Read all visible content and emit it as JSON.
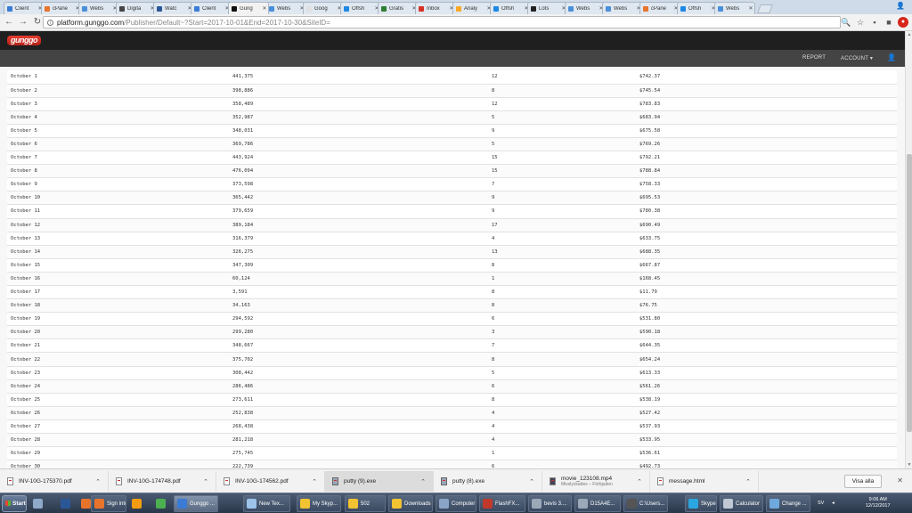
{
  "browser": {
    "tabs": [
      {
        "label": "Client",
        "color": "#3a7bd5",
        "active": false
      },
      {
        "label": "cPane",
        "color": "#e8742c",
        "active": false
      },
      {
        "label": "Webs",
        "color": "#4a8fd8",
        "active": false
      },
      {
        "label": "Digita",
        "color": "#444444",
        "active": false
      },
      {
        "label": "Watc",
        "color": "#2b5797",
        "active": false
      },
      {
        "label": "Client",
        "color": "#3a7bd5",
        "active": false
      },
      {
        "label": "Gung",
        "color": "#111111",
        "active": true
      },
      {
        "label": "Webs",
        "color": "#4a8fd8",
        "active": false
      },
      {
        "label": "Goog",
        "color": "#e0e0e0",
        "active": false
      },
      {
        "label": "Offsh",
        "color": "#1e88e5",
        "active": false
      },
      {
        "label": "Gratis",
        "color": "#2e7d32",
        "active": false
      },
      {
        "label": "Inbox",
        "color": "#d93025",
        "active": false
      },
      {
        "label": "Analy",
        "color": "#f9a825",
        "active": false
      },
      {
        "label": "Offsh",
        "color": "#1e88e5",
        "active": false
      },
      {
        "label": "Lots",
        "color": "#222222",
        "active": false
      },
      {
        "label": "Webs",
        "color": "#4a8fd8",
        "active": false
      },
      {
        "label": "Webs",
        "color": "#4a8fd8",
        "active": false
      },
      {
        "label": "cPane",
        "color": "#e8742c",
        "active": false
      },
      {
        "label": "Offsh",
        "color": "#1e88e5",
        "active": false
      },
      {
        "label": "Webs",
        "color": "#4a8fd8",
        "active": false
      }
    ],
    "url_host": "platform.gunggo.com",
    "url_path": "/Publisher/Default~?Start=2017-10-01&End=2017-10-30&SiteID="
  },
  "site": {
    "logo_text": "gunggo",
    "nav_report": "REPORT",
    "nav_account": "ACCOUNT ▾"
  },
  "rows": [
    {
      "date": "October 1",
      "impressions": "441,375",
      "clicks": "12",
      "revenue": "$742.37"
    },
    {
      "date": "October 2",
      "impressions": "398,886",
      "clicks": "8",
      "revenue": "$745.54"
    },
    {
      "date": "October 3",
      "impressions": "358,489",
      "clicks": "12",
      "revenue": "$783.83"
    },
    {
      "date": "October 4",
      "impressions": "352,987",
      "clicks": "5",
      "revenue": "$683.94"
    },
    {
      "date": "October 5",
      "impressions": "348,031",
      "clicks": "9",
      "revenue": "$675.58"
    },
    {
      "date": "October 6",
      "impressions": "369,786",
      "clicks": "5",
      "revenue": "$769.26"
    },
    {
      "date": "October 7",
      "impressions": "443,924",
      "clicks": "15",
      "revenue": "$792.21"
    },
    {
      "date": "October 8",
      "impressions": "476,094",
      "clicks": "15",
      "revenue": "$788.84"
    },
    {
      "date": "October 9",
      "impressions": "373,598",
      "clicks": "7",
      "revenue": "$758.33"
    },
    {
      "date": "October 10",
      "impressions": "365,442",
      "clicks": "9",
      "revenue": "$695.53"
    },
    {
      "date": "October 11",
      "impressions": "379,659",
      "clicks": "9",
      "revenue": "$780.38"
    },
    {
      "date": "October 12",
      "impressions": "389,184",
      "clicks": "17",
      "revenue": "$690.49"
    },
    {
      "date": "October 13",
      "impressions": "316,379",
      "clicks": "4",
      "revenue": "$633.75"
    },
    {
      "date": "October 14",
      "impressions": "326,275",
      "clicks": "13",
      "revenue": "$688.35"
    },
    {
      "date": "October 15",
      "impressions": "347,309",
      "clicks": "8",
      "revenue": "$667.87"
    },
    {
      "date": "October 16",
      "impressions": "60,124",
      "clicks": "1",
      "revenue": "$168.45"
    },
    {
      "date": "October 17",
      "impressions": "3,591",
      "clicks": "8",
      "revenue": "$11.79"
    },
    {
      "date": "October 18",
      "impressions": "34,163",
      "clicks": "8",
      "revenue": "$76.75"
    },
    {
      "date": "October 19",
      "impressions": "294,592",
      "clicks": "6",
      "revenue": "$531.80"
    },
    {
      "date": "October 20",
      "impressions": "299,280",
      "clicks": "3",
      "revenue": "$590.18"
    },
    {
      "date": "October 21",
      "impressions": "348,667",
      "clicks": "7",
      "revenue": "$644.35"
    },
    {
      "date": "October 22",
      "impressions": "375,702",
      "clicks": "8",
      "revenue": "$654.24"
    },
    {
      "date": "October 23",
      "impressions": "308,442",
      "clicks": "5",
      "revenue": "$613.33"
    },
    {
      "date": "October 24",
      "impressions": "286,486",
      "clicks": "6",
      "revenue": "$561.26"
    },
    {
      "date": "October 25",
      "impressions": "273,611",
      "clicks": "8",
      "revenue": "$538.19"
    },
    {
      "date": "October 26",
      "impressions": "252,838",
      "clicks": "4",
      "revenue": "$527.42"
    },
    {
      "date": "October 27",
      "impressions": "268,438",
      "clicks": "4",
      "revenue": "$537.93"
    },
    {
      "date": "October 28",
      "impressions": "281,218",
      "clicks": "4",
      "revenue": "$533.95"
    },
    {
      "date": "October 29",
      "impressions": "275,745",
      "clicks": "1",
      "revenue": "$536.61"
    },
    {
      "date": "October 30",
      "impressions": "222,739",
      "clicks": "6",
      "revenue": "$492.73"
    }
  ],
  "downloads": {
    "items": [
      {
        "name": "INV-10G-175370.pdf",
        "sub": "",
        "kind": "pdf",
        "highlight": false
      },
      {
        "name": "INV-10G-174748.pdf",
        "sub": "",
        "kind": "pdf",
        "highlight": false
      },
      {
        "name": "INV-10G-174562.pdf",
        "sub": "",
        "kind": "pdf",
        "highlight": false
      },
      {
        "name": "putty (9).exe",
        "sub": "",
        "kind": "exe",
        "highlight": true
      },
      {
        "name": "putty (8).exe",
        "sub": "",
        "kind": "exe",
        "highlight": false
      },
      {
        "name": "movie_123108.mp4",
        "sub": "Misslyckades – Förbjuden",
        "kind": "mp4",
        "highlight": false
      },
      {
        "name": "message.html",
        "sub": "",
        "kind": "html",
        "highlight": false
      }
    ],
    "show_all": "Visa alla"
  },
  "taskbar": {
    "start_label": "Start",
    "buttons": [
      {
        "label": "Sign into...",
        "color": "#e8742c"
      },
      {
        "label": "Gunggo ...",
        "color": "#3a7bd5",
        "active": true
      },
      {
        "label": "New Tex...",
        "color": "#9cc3e8"
      },
      {
        "label": "My Skyp...",
        "color": "#f1c232"
      },
      {
        "label": "502",
        "color": "#f1c232"
      },
      {
        "label": "Downloads",
        "color": "#f1c232"
      },
      {
        "label": "Computer",
        "color": "#8aa4c8"
      },
      {
        "label": "FlashFX...",
        "color": "#c0392b"
      },
      {
        "label": "bevis 3....",
        "color": "#9aa8b8"
      },
      {
        "label": "D15A4E...",
        "color": "#9aa8b8"
      },
      {
        "label": "C:\\Users...",
        "color": "#555555"
      },
      {
        "label": "Skype [3]",
        "color": "#2aa7e0"
      },
      {
        "label": "Calculator",
        "color": "#bfc8d4"
      },
      {
        "label": "Change ...",
        "color": "#6fa8dc"
      }
    ],
    "lang": "SV",
    "time": "9:06 AM",
    "date": "12/12/2017"
  },
  "colors": {
    "header_bg": "#1f1f1f",
    "subnav_bg": "#444444",
    "logo_red": "#e63b2e"
  }
}
